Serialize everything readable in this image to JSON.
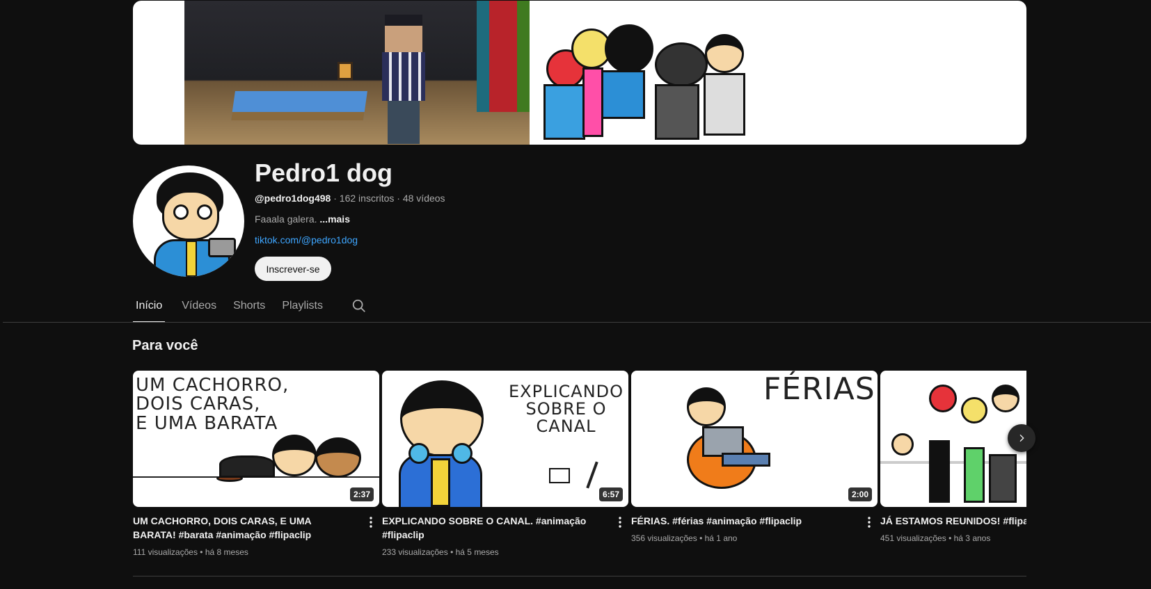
{
  "channel": {
    "name": "Pedro1 dog",
    "handle": "@pedro1dog498",
    "subscribers": "162 inscritos",
    "videos_count": "48 vídeos",
    "separator": "·",
    "description": "Faaala galera.",
    "more_label": "...mais",
    "link": "tiktok.com/@pedro1dog",
    "subscribe_label": "Inscrever-se"
  },
  "tabs": [
    {
      "label": "Início",
      "active": true
    },
    {
      "label": "Vídeos",
      "active": false
    },
    {
      "label": "Shorts",
      "active": false
    },
    {
      "label": "Playlists",
      "active": false
    }
  ],
  "section": {
    "title": "Para você"
  },
  "thumb_text": {
    "v1": "UM CACHORRO,\nDOIS CARAS,\nE UMA BARATA",
    "v2": "EXPLICANDO\nSOBRE O\nCANAL",
    "v3": "FÉRIAS"
  },
  "videos": [
    {
      "title": "UM CACHORRO, DOIS CARAS, E UMA BARATA! #barata #animação #flipaclip",
      "views": "111 visualizações",
      "age": "há 8 meses",
      "duration": "2:37"
    },
    {
      "title": "EXPLICANDO SOBRE O CANAL. #animação #flipaclip",
      "views": "233 visualizações",
      "age": "há 5 meses",
      "duration": "6:57"
    },
    {
      "title": "FÉRIAS. #férias #animação #flipaclip",
      "views": "356 visualizações",
      "age": "há 1 ano",
      "duration": "2:00"
    },
    {
      "title": "JÁ ESTAMOS REUNIDOS! #flipaclip",
      "views": "451 visualizações",
      "age": "há 3 anos",
      "duration": ""
    }
  ],
  "meta_dot": "•",
  "icons": {
    "search": "search-icon",
    "kebab": "more-vert-icon",
    "next": "chevron-right-icon"
  },
  "colors": {
    "background": "#0f0f0f",
    "text": "#f1f1f1",
    "secondary": "#aaaaaa",
    "link": "#3ea6ff"
  }
}
